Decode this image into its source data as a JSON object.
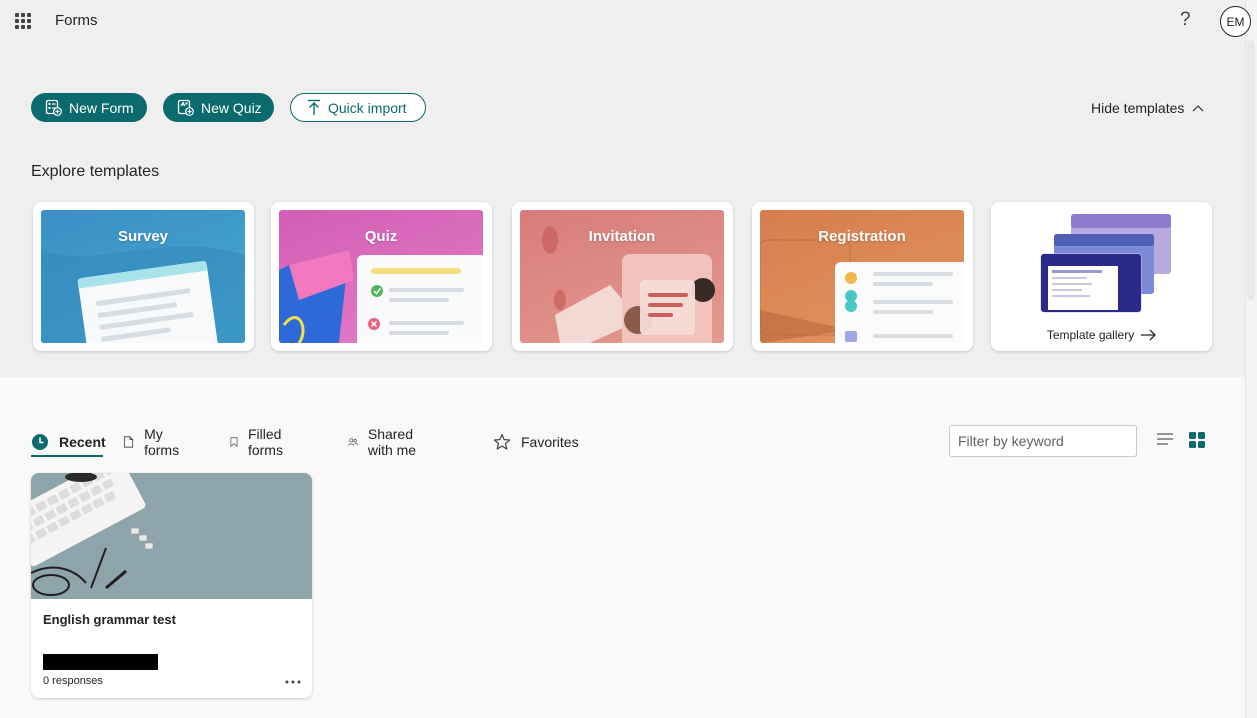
{
  "header": {
    "app_title": "Forms",
    "help_label": "?",
    "avatar_initials": "EM"
  },
  "actions": {
    "new_form": "New Form",
    "new_quiz": "New Quiz",
    "quick_import": "Quick import",
    "hide_templates": "Hide templates"
  },
  "templates": {
    "section_title": "Explore templates",
    "items": [
      {
        "label": "Survey"
      },
      {
        "label": "Quiz"
      },
      {
        "label": "Invitation"
      },
      {
        "label": "Registration"
      }
    ],
    "gallery_label": "Template gallery"
  },
  "tabs": [
    {
      "label": "Recent",
      "icon": "clock-icon",
      "active": true
    },
    {
      "label": "My forms",
      "icon": "document-icon"
    },
    {
      "label": "Filled forms",
      "icon": "bookmark-icon"
    },
    {
      "label": "Shared with me",
      "icon": "people-icon"
    },
    {
      "label": "Favorites",
      "icon": "star-icon"
    }
  ],
  "filter": {
    "placeholder": "Filter by keyword"
  },
  "forms": [
    {
      "title": "English grammar test",
      "responses": "0 responses"
    }
  ],
  "colors": {
    "accent": "#0b6a6d",
    "header_bg": "#efefef",
    "page_bg": "#faf9f8"
  }
}
